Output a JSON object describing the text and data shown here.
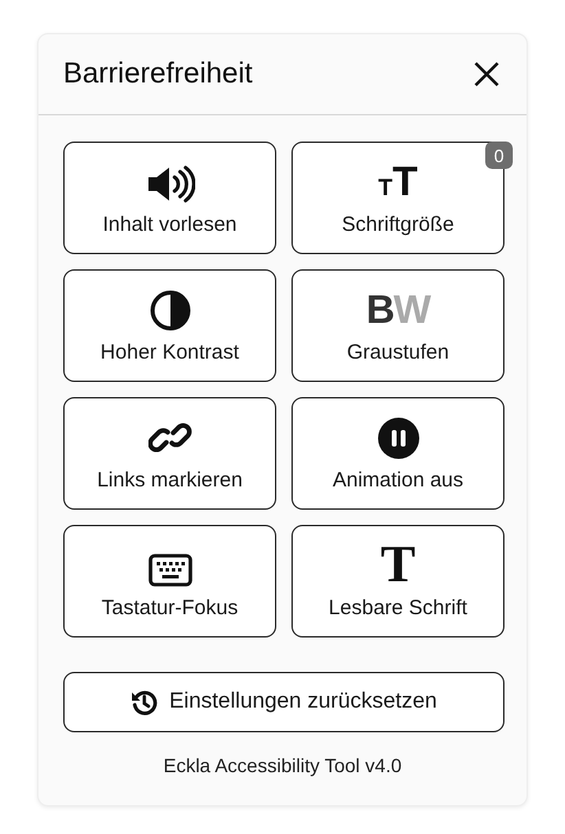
{
  "panel": {
    "title": "Barrierefreiheit"
  },
  "tile_rows": [
    {
      "tiles": [
        {
          "kind": "speaker",
          "label": "Inhalt vorlesen"
        },
        {
          "kind": "text-size",
          "glyph": "TT",
          "label": "Schriftgröße",
          "badge": "0"
        }
      ]
    },
    {
      "tiles": [
        {
          "kind": "contrast",
          "label": "Hoher Kontrast"
        },
        {
          "kind": "grayscale",
          "glyph": "BW",
          "label": "Graustufen"
        }
      ]
    },
    {
      "tiles": [
        {
          "kind": "link",
          "label": "Links markieren"
        },
        {
          "kind": "pause",
          "label": "Animation aus"
        }
      ]
    },
    {
      "tiles": [
        {
          "kind": "keyboard",
          "label": "Tastatur-Fokus"
        },
        {
          "kind": "serif",
          "glyph": "T",
          "label": "Lesbare Schrift"
        }
      ]
    }
  ],
  "reset_button": {
    "label": "Einstellungen zurücksetzen"
  },
  "footer": "Eckla Accessibility Tool v4.0"
}
